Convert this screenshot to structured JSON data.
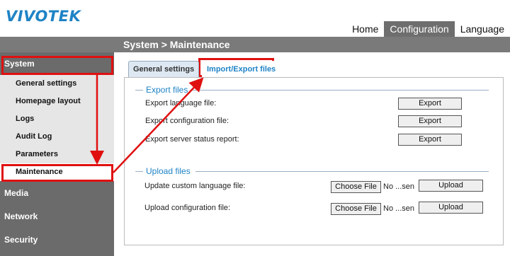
{
  "brand": {
    "logo": "VIVOTEK"
  },
  "topnav": {
    "home": "Home",
    "configuration": "Configuration",
    "language": "Language"
  },
  "breadcrumb": "System  > Maintenance",
  "sidebar": {
    "system": "System",
    "items": [
      "General settings",
      "Homepage layout",
      "Logs",
      "Audit Log",
      "Parameters",
      "Maintenance"
    ],
    "media": "Media",
    "network": "Network",
    "security": "Security"
  },
  "tabs": {
    "general": "General settings",
    "import_export": "Import/Export files"
  },
  "export": {
    "title": "Export files",
    "rows": [
      {
        "label": "Export language file:",
        "button": "Export"
      },
      {
        "label": "Export configuration file:",
        "button": "Export"
      },
      {
        "label": "Export server status report:",
        "button": "Export"
      }
    ]
  },
  "upload": {
    "title": "Upload files",
    "rows": [
      {
        "label": "Update custom language file:",
        "choose": "Choose File",
        "status": "No ...sen",
        "button": "Upload"
      },
      {
        "label": "Upload configuration file:",
        "choose": "Choose File",
        "status": "No ...sen",
        "button": "Upload"
      }
    ]
  },
  "colors": {
    "accent": "#1e83c6",
    "highlight": "#e01010",
    "sidebar": "#6b6b6b"
  }
}
